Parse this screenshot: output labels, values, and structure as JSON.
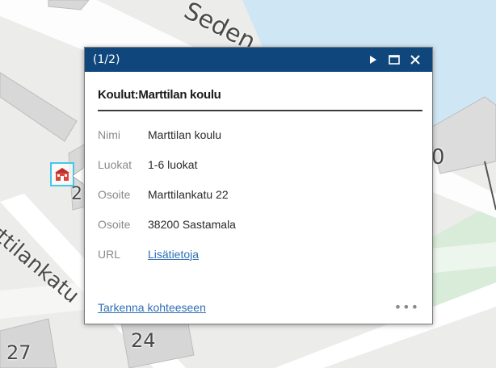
{
  "map": {
    "street_top": "Seden",
    "street_left": "rttilankatu",
    "number_2": "2",
    "number_24": "24",
    "number_27": "27",
    "number_0": "0",
    "colors": {
      "water": "#cfe7f5",
      "park": "#d8ecd9",
      "land": "#ececea",
      "building": "#d8d8d8"
    }
  },
  "popup": {
    "count": "(1/2)",
    "header_color": "#0f477c",
    "icons": {
      "next": "play-triangle-icon",
      "maximize": "maximize-icon",
      "close": "close-icon"
    },
    "title": "Koulut:Marttilan koulu",
    "attributes": [
      {
        "key": "Nimi",
        "value": "Marttilan koulu"
      },
      {
        "key": "Luokat",
        "value": "1-6 luokat"
      },
      {
        "key": "Osoite",
        "value": "Marttilankatu 22"
      },
      {
        "key": "Osoite",
        "value": "38200 Sastamala"
      }
    ],
    "url_key": "URL",
    "url_link": "Lisätietoja",
    "zoom_link": "Tarkenna kohteeseen",
    "more": "•••"
  }
}
